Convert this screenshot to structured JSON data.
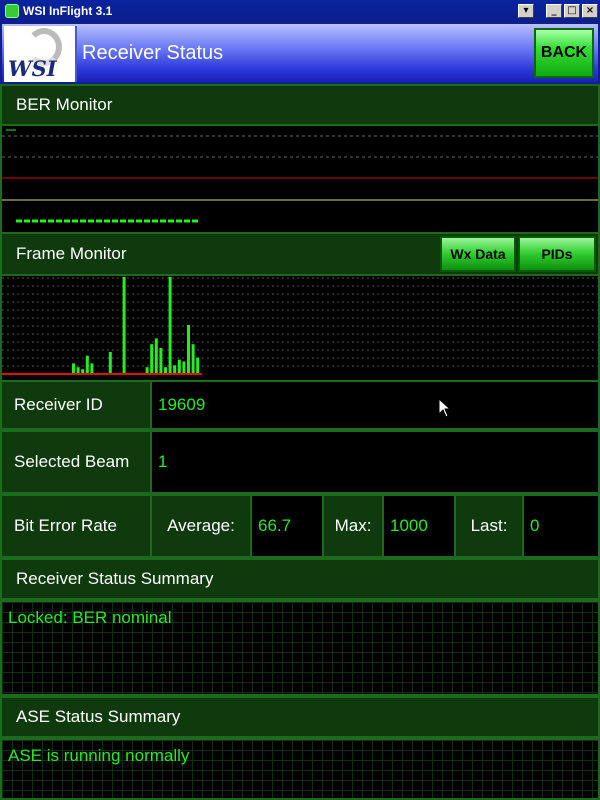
{
  "window": {
    "title": "WSI InFlight 3.1",
    "minimize": "_",
    "restore": "□",
    "close": "×",
    "menu": "▾"
  },
  "header": {
    "logo_text": "WSI",
    "title": "Receiver Status",
    "back_label": "BACK"
  },
  "ber_monitor": {
    "title": "BER Monitor"
  },
  "frame_monitor": {
    "title": "Frame Monitor",
    "wx_data_label": "Wx Data",
    "pids_label": "PIDs",
    "bar_values": [
      0.1,
      0.06,
      0.04,
      0.18,
      0.1,
      0,
      0,
      0,
      0.22,
      0,
      0,
      1.0,
      0,
      0,
      0,
      0,
      0.06,
      0.3,
      0.36,
      0.26,
      0.06,
      1.0,
      0.08,
      0.14,
      0.12,
      0.5,
      0.3,
      0.16
    ]
  },
  "receiver_id": {
    "label": "Receiver ID",
    "value": "19609"
  },
  "selected_beam": {
    "label": "Selected Beam",
    "value": "1"
  },
  "bit_error_rate": {
    "label": "Bit Error Rate",
    "average_label": "Average:",
    "average_value": "66.7",
    "max_label": "Max:",
    "max_value": "1000",
    "last_label": "Last:",
    "last_value": "0"
  },
  "receiver_summary": {
    "title": "Receiver Status Summary",
    "text": "Locked: BER nominal"
  },
  "ase_summary": {
    "title": "ASE Status Summary",
    "text": "ASE is running normally"
  },
  "colors": {
    "accent_green": "#22ee22",
    "panel_green": "#0e3a0e",
    "border_green": "#1c6a1c",
    "header_blue": "#2a35d8"
  }
}
